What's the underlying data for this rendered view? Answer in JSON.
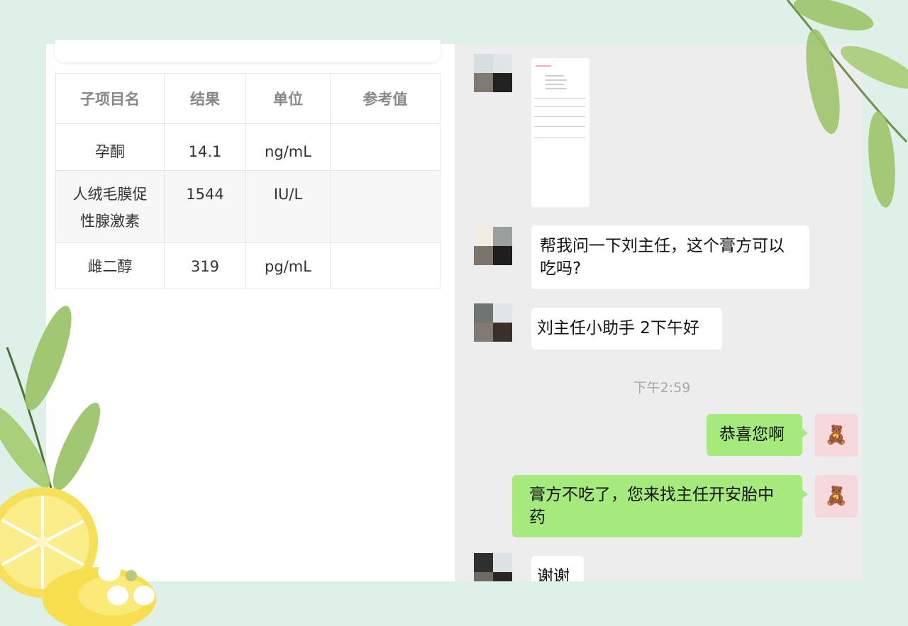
{
  "report": {
    "headers": [
      "子项目名",
      "结果",
      "单位",
      "参考值"
    ],
    "rows": [
      {
        "name": "孕酮",
        "result": "14.1",
        "unit": "ng/mL",
        "ref": ""
      },
      {
        "name_l1": "人绒毛膜促",
        "name_l2": "性腺激素",
        "result": "1544",
        "unit": "IU/L",
        "ref": ""
      },
      {
        "name": "雌二醇",
        "result": "319",
        "unit": "pg/mL",
        "ref": ""
      }
    ]
  },
  "chat": {
    "msg1_l1": "帮我问一下刘主任，这个膏方可以",
    "msg1_l2": "吃吗?",
    "msg2": "刘主任小助手 2下午好",
    "timestamp": "下午2:59",
    "msg3": "恭喜您啊",
    "msg4_l1": "膏方不吃了，您来找主任开安胎中",
    "msg4_l2": "药",
    "msg5": "谢谢"
  },
  "colors": {
    "background": "#dff0e8",
    "chat_bg": "#ededed",
    "my_bubble": "#a6e97d",
    "their_bubble": "#ffffff"
  },
  "icons": [
    "leaf-branch-icon",
    "lemon-slice-icon",
    "flower-icon",
    "bear-sticker-icon"
  ]
}
